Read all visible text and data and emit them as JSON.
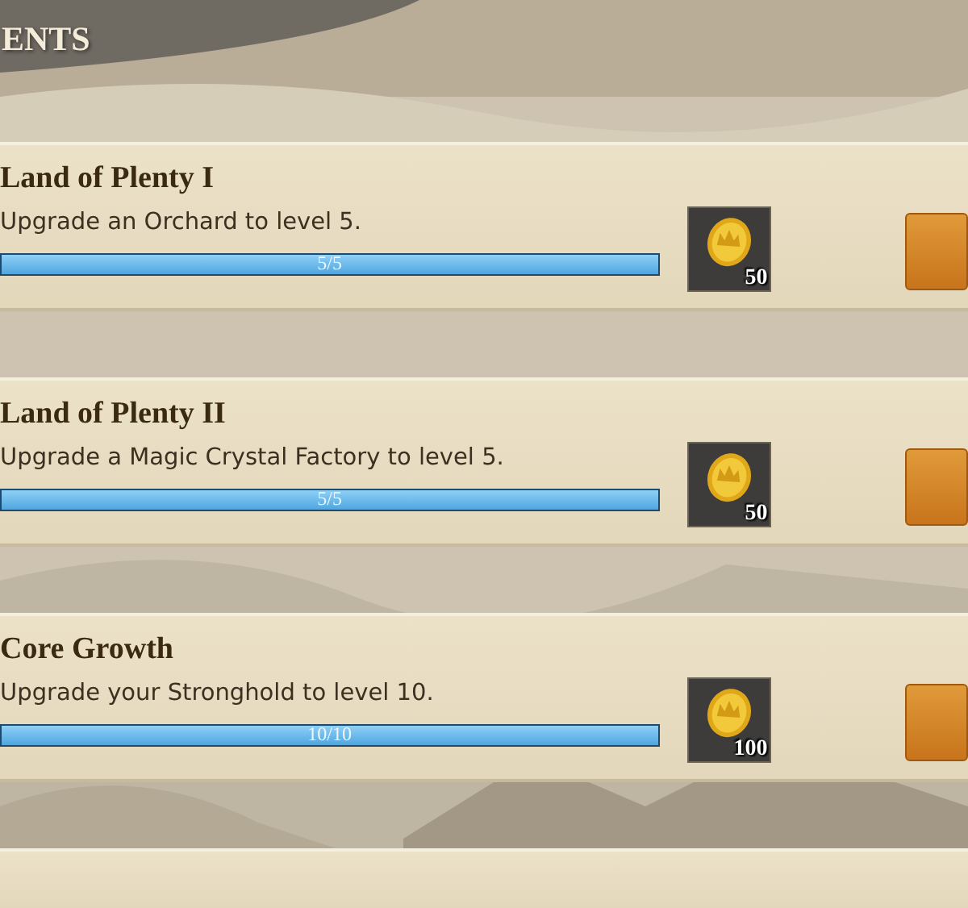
{
  "header": {
    "title": "ENTS"
  },
  "achievements": [
    {
      "title": "Land of Plenty I",
      "description": "Upgrade an Orchard to level 5.",
      "progress": {
        "level": 1,
        "reading": "5/5"
      },
      "reward": {
        "count": "50"
      }
    },
    {
      "title": "Land of Plenty II",
      "description": "Upgrade a Magic Crystal Factory to level 5.",
      "progress": {
        "level": 1,
        "reading": "5/5"
      },
      "reward": {
        "count": "50"
      }
    },
    {
      "title": "Core Growth",
      "description": "Upgrade your Stronghold to level 10.",
      "progress": {
        "level": 1,
        "reading": "10/10"
      },
      "reward": {
        "count": "100"
      }
    }
  ]
}
